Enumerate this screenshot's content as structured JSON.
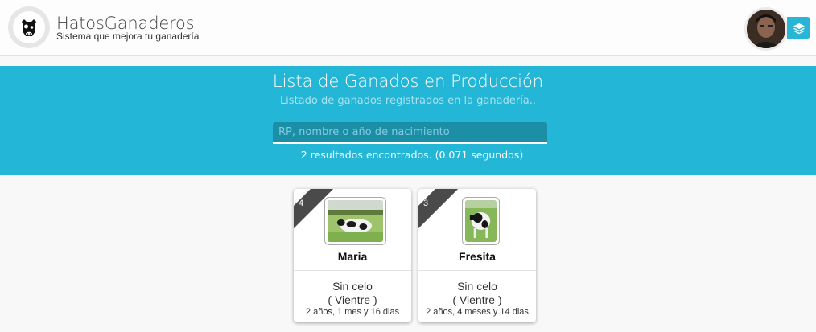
{
  "header": {
    "app_title": "HatosGanaderos",
    "app_subtitle": "Sistema que mejora tu ganadería",
    "logo_icon": "cow-logo-icon",
    "avatar_icon": "user-avatar",
    "menu_icon": "layers-icon",
    "accent_color": "#29b6d6"
  },
  "banner": {
    "title": "Lista de Ganados en Producción",
    "subtitle": "Listado de ganados registrados en la ganadería..",
    "search_placeholder": "RP, nombre o año de nacimiento",
    "search_value": "",
    "results_text": "2 resultados encontrados. (0.071 segundos)",
    "background_color": "#23b6d6"
  },
  "cards": [
    {
      "badge": "4",
      "name": "Maria",
      "status": "Sin celo",
      "type": "( Vientre )",
      "age": "2 años, 1 mes y 16 dias"
    },
    {
      "badge": "3",
      "name": "Fresita",
      "status": "Sin celo",
      "type": "( Vientre )",
      "age": "2 años, 4 meses y 14 dias"
    }
  ]
}
